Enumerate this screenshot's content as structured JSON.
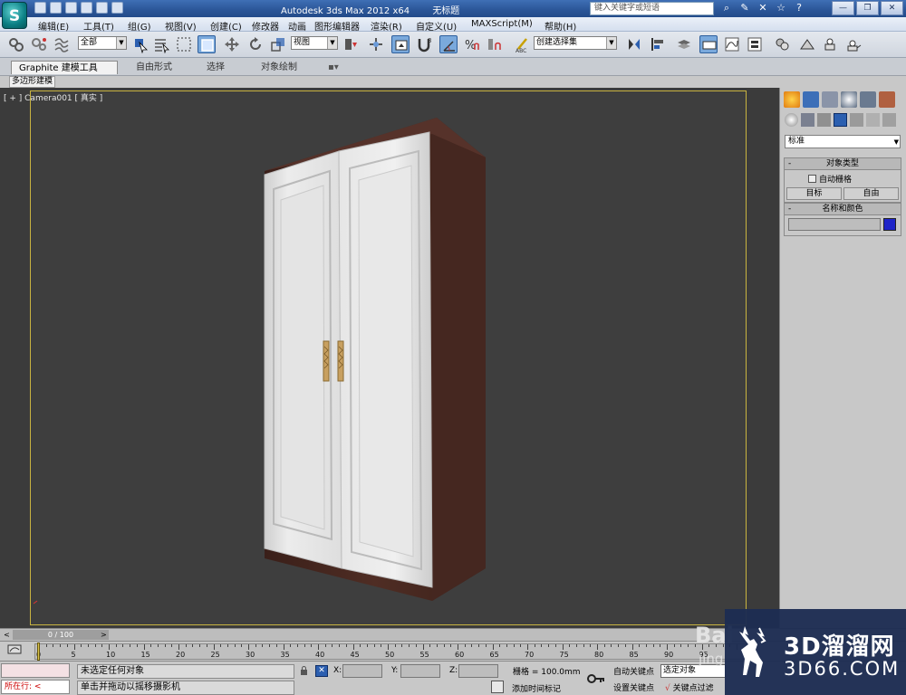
{
  "titlebar": {
    "app_title": "Autodesk 3ds Max  2012 x64",
    "doc_title": "无标题",
    "search_placeholder": "键入关键字或短语",
    "help_label": "?"
  },
  "menu": [
    {
      "label": "编辑(E)"
    },
    {
      "label": "工具(T)"
    },
    {
      "label": "组(G)"
    },
    {
      "label": "视图(V)"
    },
    {
      "label": "创建(C)"
    },
    {
      "label": "修改器"
    },
    {
      "label": "动画"
    },
    {
      "label": "图形编辑器"
    },
    {
      "label": "渲染(R)"
    },
    {
      "label": "自定义(U)"
    },
    {
      "label": "MAXScript(M)"
    },
    {
      "label": "帮助(H)"
    }
  ],
  "toolbar": {
    "selection_filter": "全部",
    "reference_coord": "视图",
    "named_selection": "创建选择集"
  },
  "ribbon": {
    "tabs": [
      {
        "label": "Graphite 建模工具"
      },
      {
        "label": "自由形式"
      },
      {
        "label": "选择"
      },
      {
        "label": "对象绘制"
      }
    ],
    "panel_label": "多边形建模"
  },
  "viewport": {
    "label": "[ + ] Camera001 [ 真实 ]"
  },
  "command_panel": {
    "category": "标准",
    "object_type_title": "对象类型",
    "autogrid_label": "自动栅格",
    "btn_target": "目标",
    "btn_free": "自由",
    "name_color_title": "名称和颜色",
    "object_color": "#1e24c8"
  },
  "timeline": {
    "frame_label": "0 / 100",
    "ticks": [
      "0",
      "5",
      "10",
      "15",
      "20",
      "25",
      "30",
      "35",
      "40",
      "45",
      "50",
      "55",
      "60",
      "65",
      "70",
      "75",
      "80",
      "85",
      "90",
      "95"
    ]
  },
  "status": {
    "maxscript_label": "所在行:",
    "message1": "未选定任何对象",
    "message2": "单击并拖动以摇移摄影机",
    "x_label": "X:",
    "y_label": "Y:",
    "z_label": "Z:",
    "grid": "栅格 = 100.0mm",
    "auto_key": "自动关键点",
    "set_key": "设置关键点",
    "selected": "选定对象",
    "key_filter": "关键点过滤",
    "add_time_tag": "添加时间标记"
  },
  "watermark": {
    "brand_cn": "3D溜溜网",
    "brand_url": "3D66.COM",
    "baidu": "Bai",
    "jing": "jing"
  },
  "colors": {
    "viewport_bg": "#3e3e3e",
    "viewport_border": "#c9b440",
    "door_white": "#e9e9e9",
    "cabinet_wood": "#4a2a22",
    "handle_gold": "#c8a060"
  }
}
